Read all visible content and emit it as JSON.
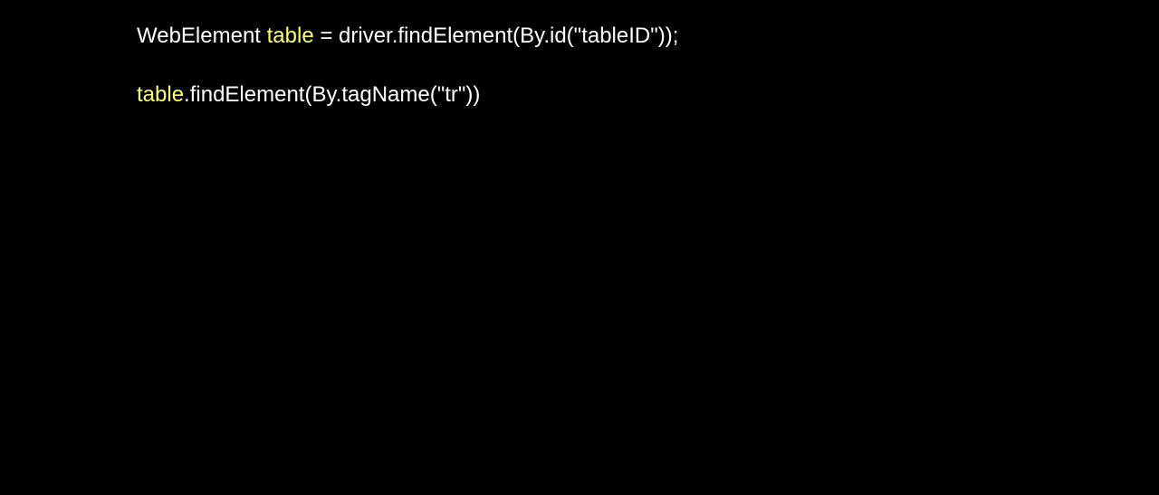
{
  "colors": {
    "background": "#000000",
    "text": "#ffffff",
    "highlight": "#ffff66"
  },
  "code": {
    "line1": {
      "part1": "WebElement ",
      "variable": "table",
      "part2": " = driver.findElement(By.id(\"tableID\"));"
    },
    "line2": {
      "variable": "table",
      "part2": ".findElement(By.tagName(\"tr\"))"
    }
  }
}
